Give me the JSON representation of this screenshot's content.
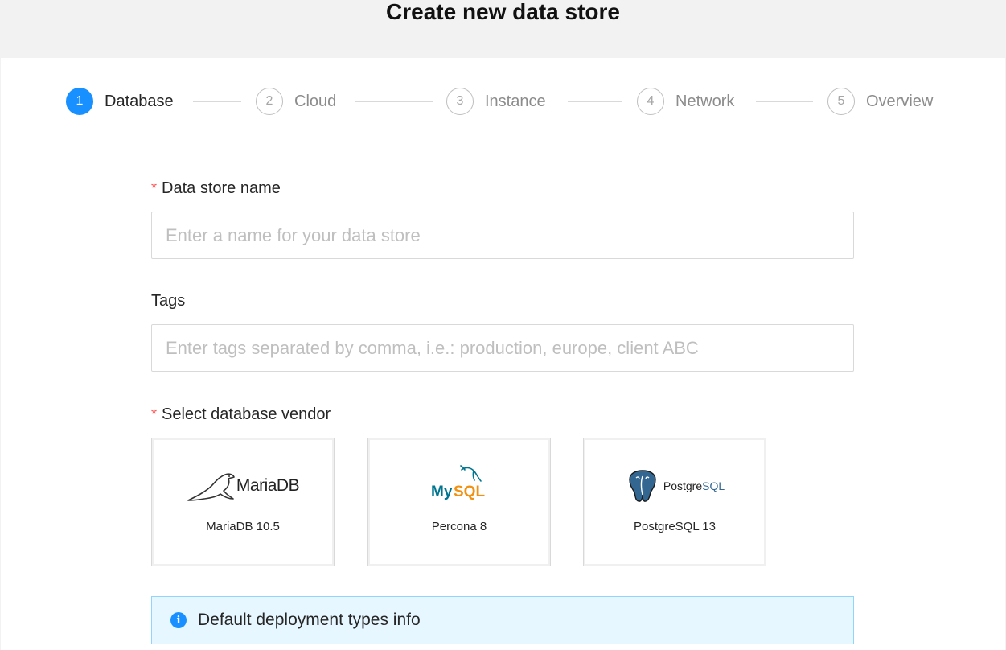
{
  "page": {
    "title": "Create new data store"
  },
  "steps": [
    {
      "number": "1",
      "label": "Database",
      "active": true
    },
    {
      "number": "2",
      "label": "Cloud"
    },
    {
      "number": "3",
      "label": "Instance"
    },
    {
      "number": "4",
      "label": "Network"
    },
    {
      "number": "5",
      "label": "Overview"
    }
  ],
  "form": {
    "name": {
      "required_mark": "*",
      "label": "Data store name",
      "placeholder": "Enter a name for your data store",
      "value": ""
    },
    "tags": {
      "label": "Tags",
      "placeholder": "Enter tags separated by comma, i.e.: production, europe, client ABC",
      "value": ""
    },
    "vendor": {
      "required_mark": "*",
      "label": "Select database vendor",
      "options": [
        {
          "name": "MariaDB 10.5",
          "logo_text": "MariaDB",
          "icon": "mariadb-seal-icon"
        },
        {
          "name": "Percona 8",
          "logo_text_my": "My",
          "logo_text_sql": "SQL",
          "icon": "mysql-dolphin-icon"
        },
        {
          "name": "PostgreSQL 13",
          "logo_text_postgre": "Postgre",
          "logo_text_sql": "SQL",
          "icon": "postgresql-elephant-icon"
        }
      ]
    }
  },
  "info": {
    "icon": "info-icon",
    "glyph": "i",
    "text": "Default deployment types info"
  },
  "colors": {
    "primary": "#1890ff",
    "required": "#ff4d4f",
    "info_bg": "#e6f7ff",
    "info_border": "#91d5ff"
  }
}
